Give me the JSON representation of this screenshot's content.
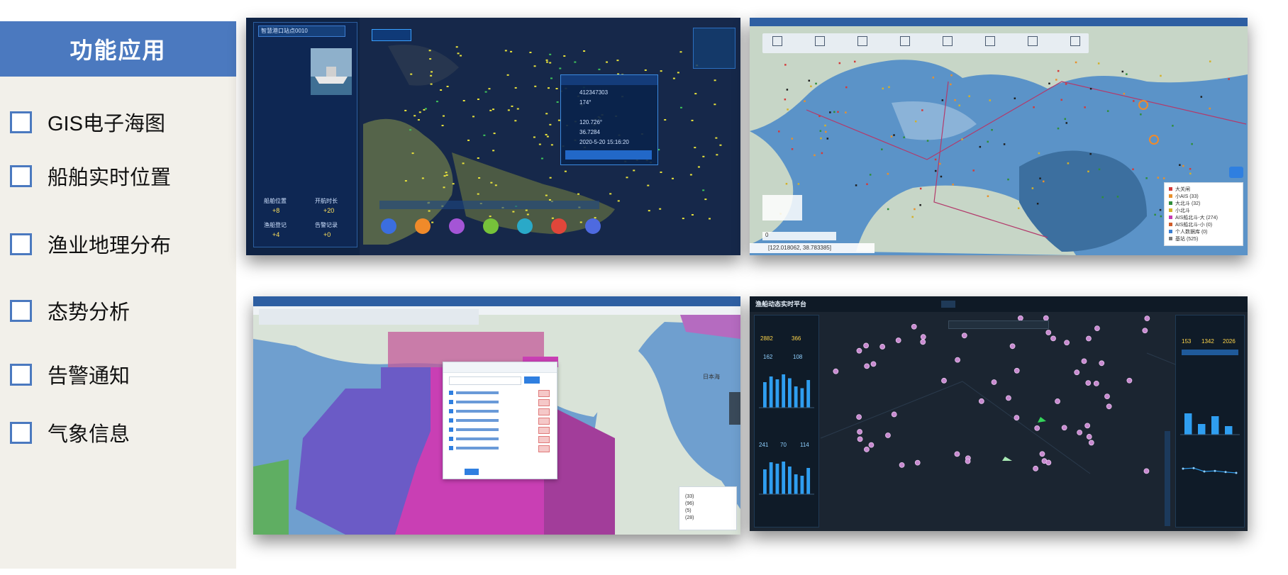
{
  "sidebar": {
    "title": "功能应用",
    "items": [
      {
        "label": "GIS电子海图"
      },
      {
        "label": "船舶实时位置"
      },
      {
        "label": "渔业地理分布"
      },
      {
        "label": "态势分析"
      },
      {
        "label": "告警通知"
      },
      {
        "label": "气象信息"
      }
    ]
  },
  "screens": {
    "s1": {
      "dropdown": "智慧港口站点0010",
      "left_stats": [
        "船舶位置",
        "开航时长",
        "渔船登记",
        "告警记录"
      ],
      "stat_values": [
        "+8",
        "+20",
        "+4",
        "+0"
      ],
      "popup_values": [
        "412347303",
        "174°",
        "120.726°",
        "36.7284"
      ],
      "popup_time": "2020-5-20 15:16:20",
      "legend_values": [
        "+8",
        "+20"
      ],
      "colors": {
        "bg": "#0b1a35",
        "sea": "#18294a",
        "land": "#55644a",
        "ship": "#e9e33b"
      }
    },
    "s2": {
      "legend": [
        {
          "label": "大关闸",
          "color": "#d43a3a"
        },
        {
          "label": "小AIS (33)",
          "color": "#e8902c"
        },
        {
          "label": "大北斗 (32)",
          "color": "#2f8e3a"
        },
        {
          "label": "小北斗",
          "color": "#d3b12a"
        },
        {
          "label": "AIS船北斗-大 (274)",
          "color": "#c43ab0"
        },
        {
          "label": "AIS船北斗-小 (0)",
          "color": "#d05c2a"
        },
        {
          "label": "个人数据库 (0)",
          "color": "#3a7ed1"
        },
        {
          "label": "基站 (525)",
          "color": "#7a7a7a"
        }
      ],
      "status": "[122.018062, 38.783385]",
      "zoom": "0",
      "colors": {
        "sea": "#5b93c8",
        "land": "#c7d6c7",
        "toolbar": "#d9e4ec"
      }
    },
    "s3": {
      "map_label": "日本海",
      "dialog_rows": 7,
      "legend_values": [
        "(33)",
        "(96)",
        "(5)",
        "(28)"
      ],
      "colors": {
        "sea": "#6f9fcf",
        "land": "#d9e3d8",
        "zone1": "#6b5bc6",
        "zone2": "#c93fb4"
      }
    },
    "s4": {
      "title": "渔船动态实时平台",
      "left_stats": [
        "2882",
        "366",
        "162",
        "108"
      ],
      "mid_stats": [
        "241",
        "70",
        "114"
      ],
      "right_values": [
        "153",
        "1342",
        "2026"
      ],
      "bars_top": [
        72,
        88,
        80,
        94,
        83,
        60,
        55,
        78
      ],
      "bars_bottom": [
        70,
        90,
        86,
        92,
        78,
        56,
        52,
        74
      ],
      "right_bars": [
        60,
        30,
        52,
        24
      ],
      "line_points": [
        70,
        72,
        60,
        62,
        58,
        55
      ],
      "colors": {
        "bg": "#16222e",
        "panel": "#0f1b28",
        "accent": "#2f9ef0"
      }
    }
  }
}
